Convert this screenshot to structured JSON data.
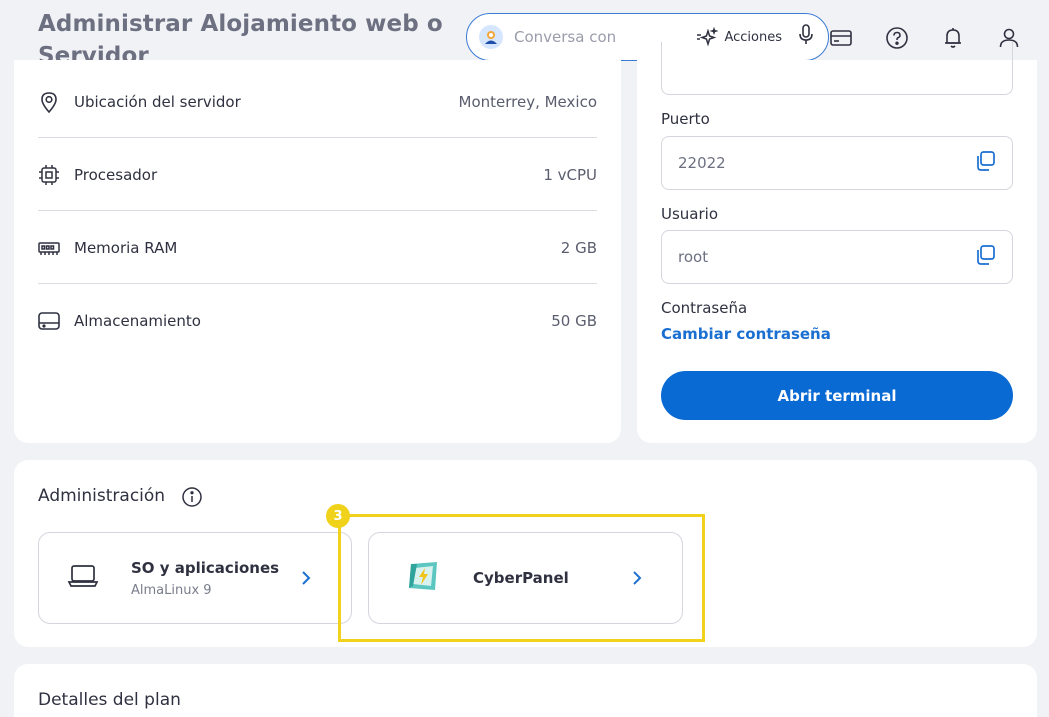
{
  "header": {
    "title": "Administrar Alojamiento web o Servidor",
    "search_placeholder": "Conversa con",
    "actions_label": "Acciones"
  },
  "specs": [
    {
      "label": "Ubicación del servidor",
      "value": "Monterrey, Mexico",
      "icon": "location-pin-icon"
    },
    {
      "label": "Procesador",
      "value": "1 vCPU",
      "icon": "cpu-icon"
    },
    {
      "label": "Memoria RAM",
      "value": "2 GB",
      "icon": "ram-icon"
    },
    {
      "label": "Almacenamiento",
      "value": "50 GB",
      "icon": "storage-icon"
    }
  ],
  "access": {
    "port_label": "Puerto",
    "port_value": "22022",
    "user_label": "Usuario",
    "user_value": "root",
    "password_label": "Contraseña",
    "change_password": "Cambiar contraseña",
    "open_terminal": "Abrir terminal"
  },
  "admin": {
    "title": "Administración",
    "os_tile": {
      "name": "SO y aplicaciones",
      "sub": "AlmaLinux 9"
    },
    "cp_tile": {
      "name": "CyberPanel"
    },
    "step_number": "3"
  },
  "plan": {
    "title": "Detalles del plan"
  },
  "colors": {
    "accent": "#0a6ad3",
    "link": "#1a6fd1",
    "highlight": "#f0d21a",
    "background": "#f1f2f6"
  }
}
